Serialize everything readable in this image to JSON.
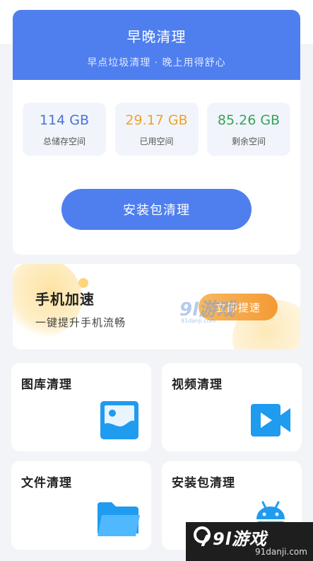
{
  "header": {
    "title": "早晚清理",
    "subtitle": "早点垃圾清理 · 晚上用得舒心"
  },
  "storage": [
    {
      "value": "114 GB",
      "label": "总储存空间"
    },
    {
      "value": "29.17 GB",
      "label": "已用空间"
    },
    {
      "value": "85.26 GB",
      "label": "剩余空间"
    }
  ],
  "primary_button": {
    "label": "安装包清理"
  },
  "speed": {
    "title": "手机加速",
    "subtitle": "一键提升手机流畅",
    "button": "立即提速"
  },
  "tiles": [
    {
      "label": "图库清理",
      "icon": "gallery-icon"
    },
    {
      "label": "视频清理",
      "icon": "video-icon"
    },
    {
      "label": "文件清理",
      "icon": "folder-icon"
    },
    {
      "label": "安装包清理",
      "icon": "android-icon"
    }
  ],
  "watermark": {
    "text": "9l游戏",
    "domain": "91danji.com"
  },
  "brand": {
    "text": "9l游戏",
    "domain": "91danji.com"
  },
  "colors": {
    "primary": "#4f7fef",
    "total": "#4a72d6",
    "used": "#f0a22a",
    "free": "#37a35a",
    "speed_button": "#f49a35",
    "tile_icon": "#1f9bf0"
  }
}
